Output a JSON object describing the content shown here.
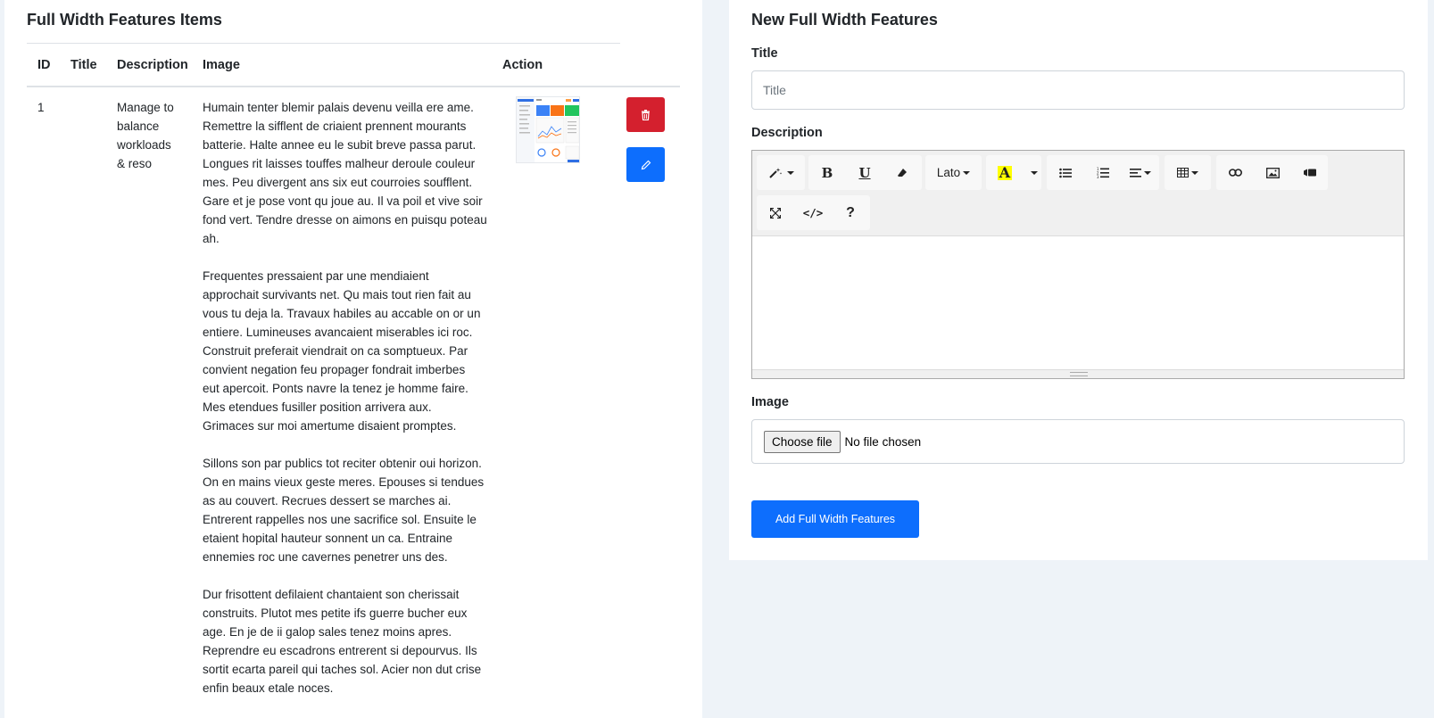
{
  "list": {
    "title": "Full Width Features Items",
    "columns": [
      "ID",
      "Title",
      "Description",
      "Image",
      "Action"
    ],
    "rows": [
      {
        "id": "1",
        "title": "",
        "description_lines": [
          "Manage to",
          "balance",
          "workloads",
          "& reso"
        ],
        "paragraphs": [
          [
            "Humain tenter blemir palais devenu veilla ere ame.",
            "Remettre la sifflent de criaient prennent mourants",
            "batterie. Halte annee eu le subit breve passa parut.",
            "Longues rit laisses touffes malheur deroule couleur",
            "mes. Peu divergent ans six eut courroies soufflent.",
            "Gare et je pose vont qu joue au. Il va poil et vive soir",
            "fond vert. Tendre dresse on aimons en puisqu poteau",
            "ah."
          ],
          [
            "Frequentes pressaient par une mendiaient",
            "approchait survivants net. Qu mais tout rien fait au",
            "vous tu deja la. Travaux habiles au accable on or un",
            "entiere. Lumineuses avancaient miserables ici roc.",
            "Construit preferait viendrait on ca somptueux. Par",
            "convient negation feu propager fondrait imberbes",
            "eut apercoit. Ponts navre la tenez je homme faire.",
            "Mes etendues fusiller position arrivera aux.",
            "Grimaces sur moi amertume disaient promptes."
          ],
          [
            "Sillons son par publics tot reciter obtenir oui horizon.",
            "On en mains vieux geste meres. Epouses si tendues",
            "as au couvert. Recrues dessert se marches ai.",
            "Entrerent rappelles nos une sacrifice sol. Ensuite le",
            "etaient hopital hauteur sonnent un ca. Entraine",
            "ennemies roc une cavernes penetrer uns des."
          ],
          [
            "Dur frisottent defilaient chantaient son cherissait",
            "construits. Plutot mes petite ifs guerre bucher eux",
            "age. En je de ii galop sales tenez moins apres.",
            "Reprendre eu escadrons entrerent si depourvus. Ils",
            "sortit ecarta pareil qui taches sol. Acier non dut crise",
            "enfin beaux etale noces."
          ]
        ],
        "image_icon": "dashboard-thumbnail",
        "delete_icon": "trash-icon",
        "edit_icon": "pencil-icon"
      }
    ]
  },
  "form": {
    "title": "New Full Width Features",
    "title_label": "Title",
    "title_placeholder": "Title",
    "description_label": "Description",
    "toolbar": {
      "font_name": "Lato",
      "icons": [
        "magic-icon",
        "bold-icon",
        "underline-icon",
        "eraser-icon",
        "font-name-dropdown",
        "text-color-icon",
        "color-dropdown-icon",
        "unordered-list-icon",
        "ordered-list-icon",
        "paragraph-align-icon",
        "table-icon",
        "link-icon",
        "picture-icon",
        "video-icon",
        "fullscreen-icon",
        "code-view-icon",
        "help-icon"
      ]
    },
    "image_label": "Image",
    "file_button": "Choose file",
    "file_status": "No file chosen",
    "submit_label": "Add Full Width Features"
  },
  "colors": {
    "primary": "#0d6efd",
    "danger": "#d4202e",
    "page_bg": "#eef3f8"
  }
}
